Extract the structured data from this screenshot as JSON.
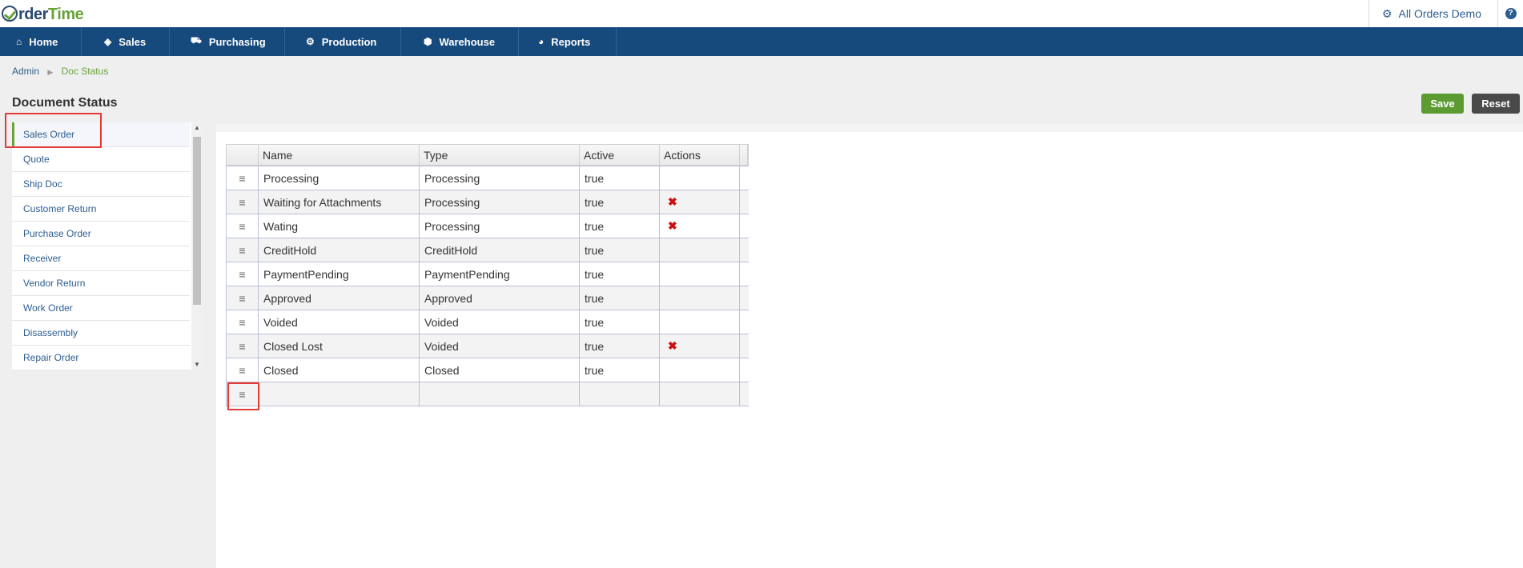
{
  "brand": {
    "logo_prefix": "rder",
    "logo_suffix": "Time"
  },
  "account": {
    "org_name": "All Orders Demo",
    "help": "?"
  },
  "nav": [
    {
      "label": "Home",
      "icon": "home-icon",
      "glyph": "⌂"
    },
    {
      "label": "Sales",
      "icon": "tag-icon",
      "glyph": "◈"
    },
    {
      "label": "Purchasing",
      "icon": "cart-icon",
      "glyph": "🛒"
    },
    {
      "label": "Production",
      "icon": "gears-icon",
      "glyph": "⚙"
    },
    {
      "label": "Warehouse",
      "icon": "box-icon",
      "glyph": "⬢"
    },
    {
      "label": "Reports",
      "icon": "pie-chart-icon",
      "glyph": "◕"
    }
  ],
  "breadcrumb": {
    "parent": "Admin",
    "current": "Doc Status"
  },
  "page_title": "Document Status",
  "buttons": {
    "save": "Save",
    "reset": "Reset"
  },
  "sidebar": {
    "items": [
      "Sales Order",
      "Quote",
      "Ship Doc",
      "Customer Return",
      "Purchase Order",
      "Receiver",
      "Vendor Return",
      "Work Order",
      "Disassembly",
      "Repair Order"
    ],
    "active": "Sales Order"
  },
  "grid": {
    "columns": [
      "Name",
      "Type",
      "Active",
      "Actions"
    ],
    "rows": [
      {
        "name": "Processing",
        "type": "Processing",
        "active": "true",
        "delete": false
      },
      {
        "name": "Waiting for Attachments",
        "type": "Processing",
        "active": "true",
        "delete": true
      },
      {
        "name": "Wating",
        "type": "Processing",
        "active": "true",
        "delete": true
      },
      {
        "name": "CreditHold",
        "type": "CreditHold",
        "active": "true",
        "delete": false
      },
      {
        "name": "PaymentPending",
        "type": "PaymentPending",
        "active": "true",
        "delete": false
      },
      {
        "name": "Approved",
        "type": "Approved",
        "active": "true",
        "delete": false
      },
      {
        "name": "Voided",
        "type": "Voided",
        "active": "true",
        "delete": false
      },
      {
        "name": "Closed Lost",
        "type": "Voided",
        "active": "true",
        "delete": true
      },
      {
        "name": "Closed",
        "type": "Closed",
        "active": "true",
        "delete": false
      },
      {
        "name": "",
        "type": "",
        "active": "",
        "delete": false
      }
    ]
  },
  "colors": {
    "nav_bg": "#174a7c",
    "accent_green": "#6aa23a",
    "link_blue": "#2c5d8f",
    "delete_red": "#cc1111",
    "highlight_red": "#e53935"
  }
}
